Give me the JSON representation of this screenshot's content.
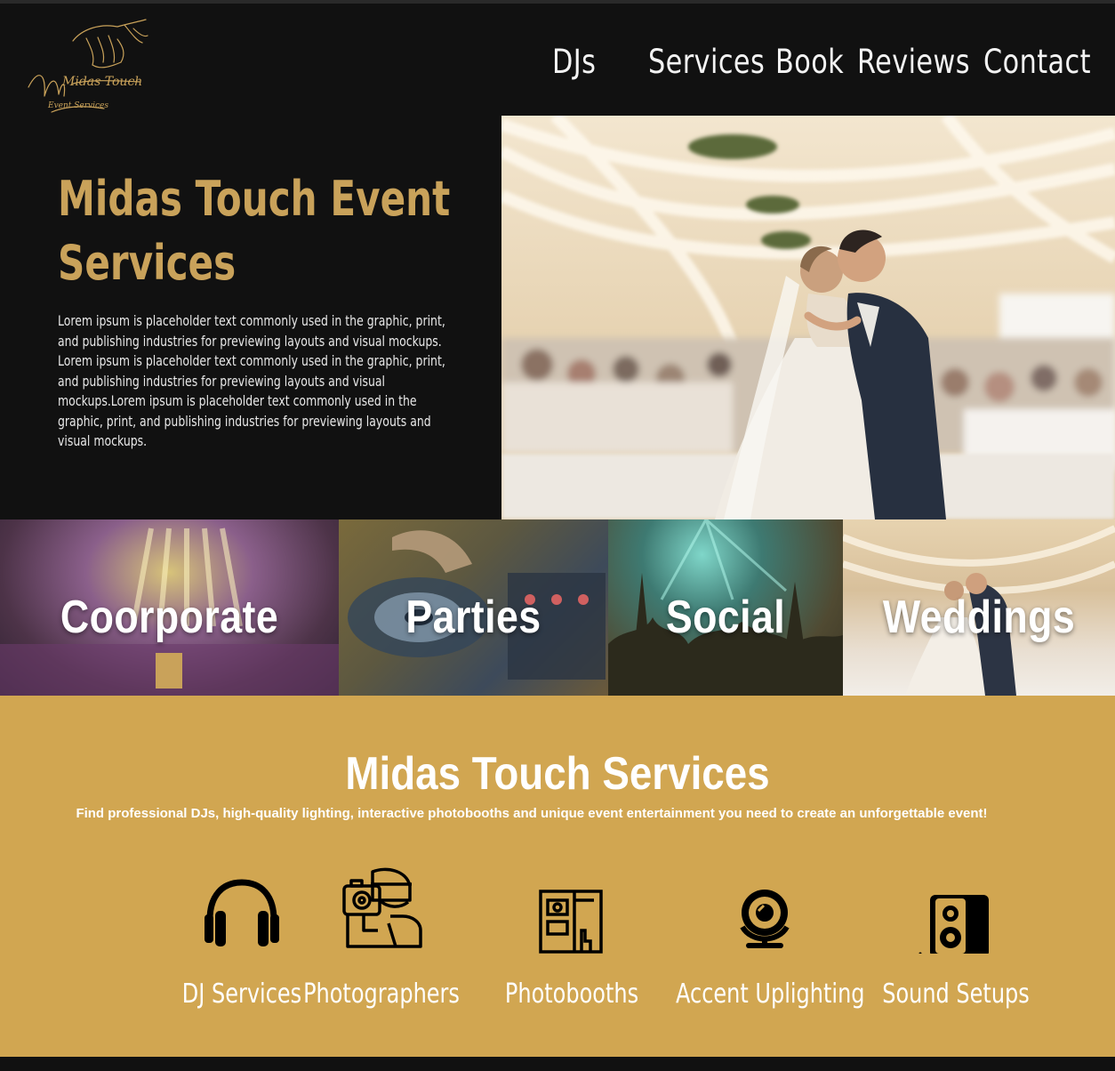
{
  "brand": {
    "logo_text": "Midas Touch",
    "logo_subtext": "Event Services",
    "gold": "#c9a25a",
    "services_bg": "#d1a651"
  },
  "nav": {
    "items": [
      "DJs",
      "Services",
      "Book",
      "Reviews",
      "Contact"
    ]
  },
  "hero": {
    "title_line1": "Midas Touch Event",
    "title_line2": "Services",
    "body": "Lorem ipsum is placeholder text commonly used in the graphic, print, and publishing industries for previewing layouts and visual mockups. Lorem ipsum is placeholder text commonly used in the graphic, print, and publishing industries for previewing layouts and visual mockups.Lorem ipsum is placeholder text commonly used in the graphic, print, and publishing industries for previewing layouts and visual mockups."
  },
  "categories": [
    "Coorporate",
    "Parties",
    "Social",
    "Weddings"
  ],
  "services": {
    "title": "Midas Touch Services",
    "subtitle": "Find professional DJs, high-quality lighting, interactive photobooths and unique event entertainment you need to create an unforgettable event!",
    "items": [
      {
        "label": "DJ Services",
        "icon": "headphones-icon"
      },
      {
        "label": "Photographers",
        "icon": "photographer-icon"
      },
      {
        "label": "Photobooths",
        "icon": "photobooth-icon"
      },
      {
        "label": "Accent Uplighting",
        "icon": "uplight-icon"
      },
      {
        "label": "Sound Setups",
        "icon": "speaker-icon"
      }
    ]
  }
}
